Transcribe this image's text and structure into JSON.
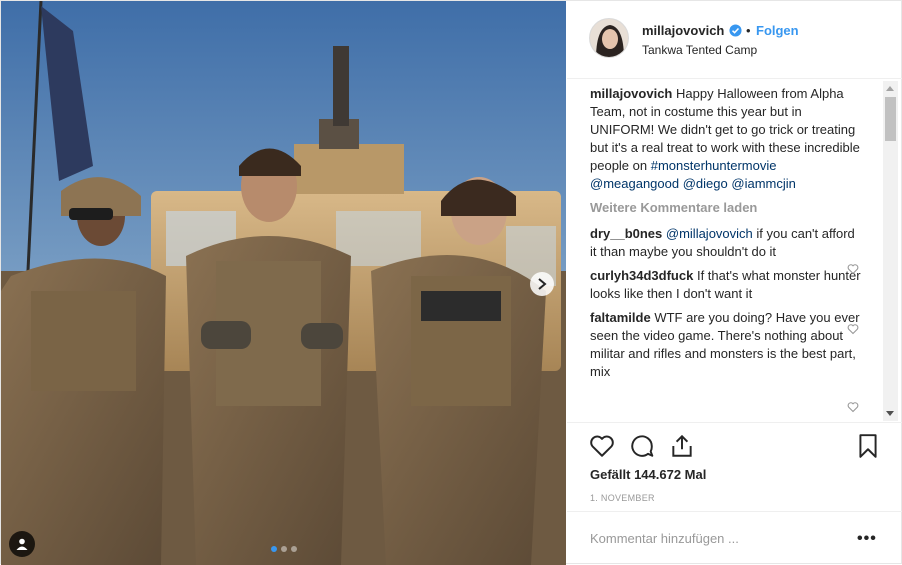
{
  "post": {
    "username": "millajovovich",
    "separator": "•",
    "follow_label": "Folgen",
    "location": "Tankwa Tented Camp",
    "caption": {
      "username": "millajovovich",
      "text": "Happy Halloween from Alpha Team, not in costume this year but in UNIFORM! We didn't get to go trick or treating but it's a real treat to work with these incredible people on",
      "tags": [
        "#monsterhuntermovie",
        "@meagangood",
        "@diego",
        "@iammcjin"
      ]
    },
    "load_more_label": "Weitere Kommentare laden",
    "comments": [
      {
        "username": "dry__b0nes",
        "mention": "@millajovovich",
        "text": "if you can't afford it than maybe you shouldn't do it"
      },
      {
        "username": "curlyh34d3dfuck",
        "mention": "",
        "text": "If that's what monster hunter looks like then I don't want it"
      },
      {
        "username": "faltamilde",
        "mention": "",
        "text": "WTF are you doing? Have you ever seen the video game. There's nothing about militar and rifles and monsters is the best part, mix"
      }
    ],
    "likes_label": "Gefällt 144.672 Mal",
    "date_label": "1. November",
    "add_comment_placeholder": "Kommentar hinzufügen ...",
    "more_options": "•••"
  },
  "colors": {
    "accent": "#3897f0",
    "link": "#003569",
    "muted": "#999999",
    "text": "#262626"
  },
  "icons": {
    "media_next": "chevron-right-icon",
    "media_tag": "user-tag-icon",
    "verified": "verified-badge-icon",
    "like": "heart-icon",
    "comment": "comment-bubble-icon",
    "share": "share-icon",
    "save": "bookmark-icon"
  },
  "carousel": {
    "slides": 3,
    "active": 1
  }
}
